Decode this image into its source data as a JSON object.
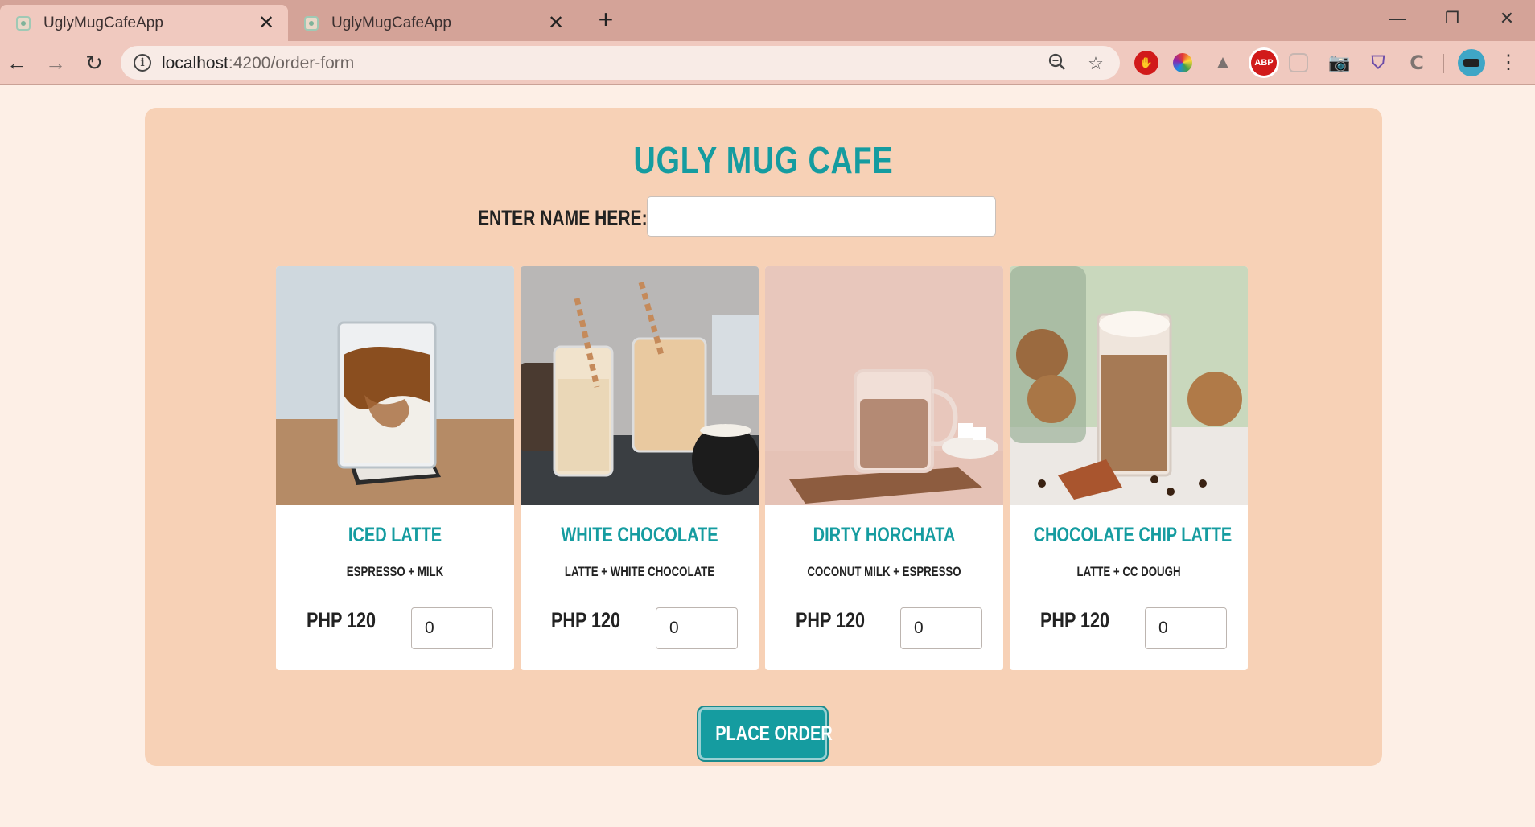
{
  "browser": {
    "tabs": [
      {
        "title": "UglyMugCafeApp",
        "active": true
      },
      {
        "title": "UglyMugCafeApp",
        "active": false
      }
    ],
    "url_host": "localhost",
    "url_path": ":4200/order-form",
    "extensions": [
      "adblock-stop-icon",
      "color-wheel-icon",
      "drive-icon",
      "abp-icon",
      "pocket-icon",
      "camera-icon",
      "shield-icon",
      "c-icon"
    ],
    "abp_label": "ABP"
  },
  "page": {
    "title": "UGLY MUG CAFE",
    "name_label": "ENTER NAME HERE:",
    "name_value": "",
    "submit_label": "PLACE ORDER",
    "items": [
      {
        "name": "ICED LATTE",
        "desc": "ESPRESSO + MILK",
        "price": "PHP 120",
        "qty": "0"
      },
      {
        "name": "WHITE CHOCOLATE",
        "desc": "LATTE + WHITE CHOCOLATE",
        "price": "PHP 120",
        "qty": "0"
      },
      {
        "name": "DIRTY HORCHATA",
        "desc": "COCONUT MILK + ESPRESSO",
        "price": "PHP 120",
        "qty": "0"
      },
      {
        "name": "CHOCOLATE CHIP LATTE",
        "desc": "LATTE + CC DOUGH",
        "price": "PHP 120",
        "qty": "0"
      }
    ]
  },
  "colors": {
    "accent": "#159ca0",
    "panel": "#f7d1b6",
    "page_bg": "#fdefe6",
    "chrome": "#d4a398"
  }
}
